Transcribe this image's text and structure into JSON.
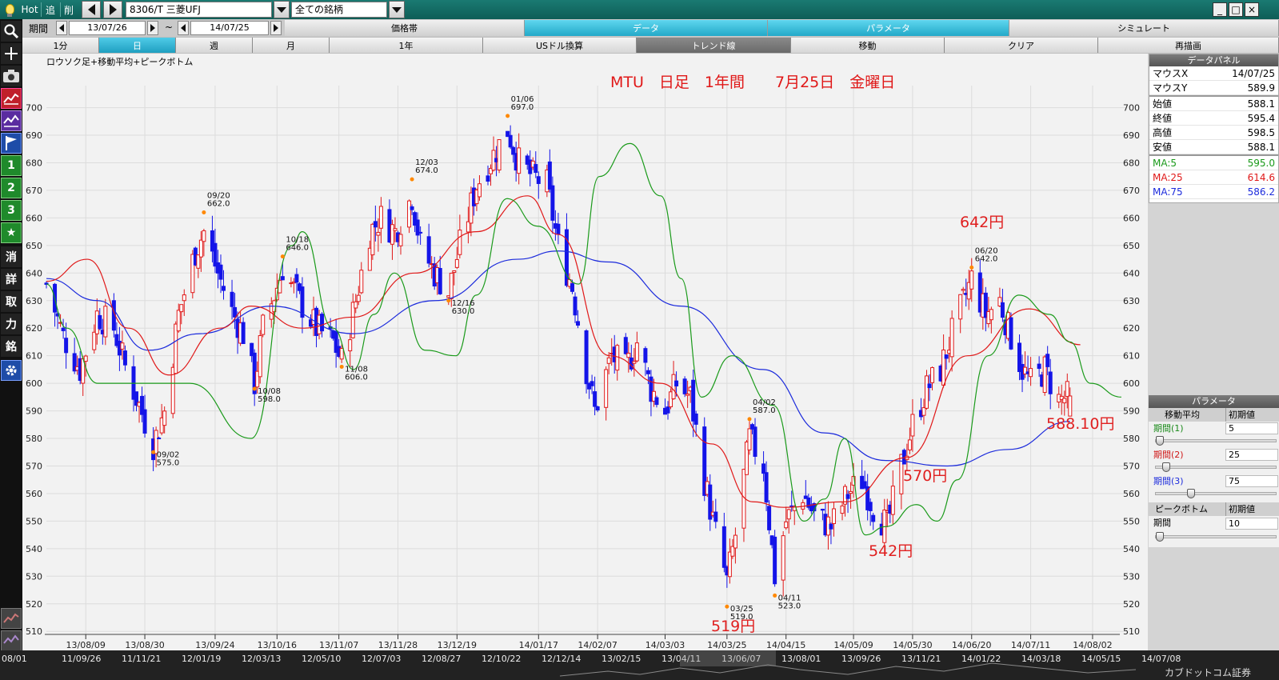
{
  "topbar": {
    "hot": "Hot",
    "add": "追",
    "del": "削",
    "symbol": "8306/T 三菱UFJ",
    "universe": "全ての銘柄",
    "win_min": "_",
    "win_max": "□",
    "win_close": "×"
  },
  "left_toolbar": [
    "1",
    "2",
    "3",
    "★",
    "消",
    "詳",
    "取",
    "力",
    "銘"
  ],
  "row2": {
    "period_label": "期間",
    "from": "13/07/26",
    "tilde": "~",
    "to": "14/07/25",
    "tabs": [
      {
        "label": "価格帯",
        "selected": false
      },
      {
        "label": "データ",
        "selected": true
      },
      {
        "label": "パラメータ",
        "selected": true
      },
      {
        "label": "シミュレート",
        "selected": false
      }
    ]
  },
  "row3": {
    "tabs": [
      {
        "label": "1分",
        "state": "normal"
      },
      {
        "label": "日",
        "state": "sel"
      },
      {
        "label": "週",
        "state": "normal"
      },
      {
        "label": "月",
        "state": "normal"
      },
      {
        "label": "1年",
        "state": "normal"
      },
      {
        "label": "USドル換算",
        "state": "normal"
      },
      {
        "label": "トレンド線",
        "state": "dark"
      },
      {
        "label": "移動",
        "state": "normal"
      },
      {
        "label": "クリア",
        "state": "normal"
      },
      {
        "label": "再描画",
        "state": "normal"
      }
    ]
  },
  "chart_title": "ロウソク足+移動平均+ピークボトム",
  "chart_data": {
    "type": "candlestick",
    "headline": "MTU　日足　1年間　　7月25日　金曜日",
    "ylim": [
      506,
      708
    ],
    "yticks": [
      510,
      520,
      530,
      540,
      550,
      560,
      570,
      580,
      590,
      600,
      610,
      620,
      630,
      640,
      650,
      660,
      670,
      680,
      690,
      700
    ],
    "x_start": "13/07/26",
    "x_end": "14/08/06",
    "xticks": [
      "13/08/09",
      "13/08/30",
      "13/09/24",
      "13/10/16",
      "13/11/07",
      "13/11/28",
      "13/12/19",
      "14/01/17",
      "14/02/07",
      "14/03/03",
      "14/03/25",
      "14/04/15",
      "14/05/09",
      "14/05/30",
      "14/06/20",
      "14/07/11",
      "14/08/02"
    ],
    "closes": [
      [
        "13/07/26",
        636
      ],
      [
        "13/08/01",
        617
      ],
      [
        "13/08/07",
        605
      ],
      [
        "13/08/13",
        625
      ],
      [
        "13/08/19",
        620
      ],
      [
        "13/08/23",
        606
      ],
      [
        "13/08/28",
        592
      ],
      [
        "13/09/02",
        578
      ],
      [
        "13/09/06",
        590
      ],
      [
        "13/09/11",
        625
      ],
      [
        "13/09/17",
        648
      ],
      [
        "13/09/20",
        655
      ],
      [
        "13/09/25",
        640
      ],
      [
        "13/09/30",
        626
      ],
      [
        "13/10/04",
        618
      ],
      [
        "13/10/08",
        600
      ],
      [
        "13/10/11",
        620
      ],
      [
        "13/10/16",
        635
      ],
      [
        "13/10/18",
        642
      ],
      [
        "13/10/24",
        630
      ],
      [
        "13/10/30",
        620
      ],
      [
        "13/11/05",
        615
      ],
      [
        "13/11/08",
        608
      ],
      [
        "13/11/13",
        630
      ],
      [
        "13/11/18",
        655
      ],
      [
        "13/11/22",
        660
      ],
      [
        "13/11/27",
        655
      ],
      [
        "13/12/03",
        668
      ],
      [
        "13/12/06",
        650
      ],
      [
        "13/12/11",
        640
      ],
      [
        "13/12/16",
        633
      ],
      [
        "13/12/20",
        650
      ],
      [
        "13/12/26",
        672
      ],
      [
        "14/01/06",
        692
      ],
      [
        "14/01/10",
        680
      ],
      [
        "14/01/15",
        675
      ],
      [
        "14/01/20",
        672
      ],
      [
        "14/01/24",
        650
      ],
      [
        "14/01/29",
        635
      ],
      [
        "14/02/03",
        605
      ],
      [
        "14/02/06",
        590
      ],
      [
        "14/02/12",
        610
      ],
      [
        "14/02/17",
        605
      ],
      [
        "14/02/21",
        615
      ],
      [
        "14/02/26",
        598
      ],
      [
        "14/03/03",
        590
      ],
      [
        "14/03/07",
        600
      ],
      [
        "14/03/12",
        595
      ],
      [
        "14/03/17",
        565
      ],
      [
        "14/03/20",
        550
      ],
      [
        "14/03/25",
        528
      ],
      [
        "14/03/28",
        545
      ],
      [
        "14/04/02",
        580
      ],
      [
        "14/04/07",
        570
      ],
      [
        "14/04/11",
        530
      ],
      [
        "14/04/15",
        550
      ],
      [
        "14/04/21",
        560
      ],
      [
        "14/04/25",
        552
      ],
      [
        "14/05/01",
        548
      ],
      [
        "14/05/07",
        560
      ],
      [
        "14/05/12",
        565
      ],
      [
        "14/05/16",
        555
      ],
      [
        "14/05/21",
        548
      ],
      [
        "14/05/26",
        570
      ],
      [
        "14/05/30",
        585
      ],
      [
        "14/06/04",
        598
      ],
      [
        "14/06/09",
        605
      ],
      [
        "14/06/13",
        618
      ],
      [
        "14/06/18",
        632
      ],
      [
        "14/06/20",
        638
      ],
      [
        "14/06/25",
        625
      ],
      [
        "14/06/30",
        630
      ],
      [
        "14/07/03",
        620
      ],
      [
        "14/07/08",
        605
      ],
      [
        "14/07/11",
        600
      ],
      [
        "14/07/16",
        605
      ],
      [
        "14/07/21",
        594
      ],
      [
        "14/07/25",
        595.4
      ]
    ],
    "ma5": [
      [
        0,
        636
      ],
      [
        0.02,
        620
      ],
      [
        0.05,
        600
      ],
      [
        0.1,
        600
      ],
      [
        0.14,
        600
      ],
      [
        0.2,
        580
      ],
      [
        0.24,
        650
      ],
      [
        0.25,
        655
      ],
      [
        0.28,
        620
      ],
      [
        0.3,
        605
      ],
      [
        0.32,
        625
      ],
      [
        0.34,
        640
      ],
      [
        0.37,
        612
      ],
      [
        0.4,
        610
      ],
      [
        0.42,
        632
      ],
      [
        0.45,
        667
      ],
      [
        0.48,
        657
      ],
      [
        0.52,
        636
      ],
      [
        0.54,
        675
      ],
      [
        0.57,
        687
      ],
      [
        0.6,
        668
      ],
      [
        0.62,
        638
      ],
      [
        0.64,
        595
      ],
      [
        0.67,
        610
      ],
      [
        0.71,
        592
      ],
      [
        0.74,
        550
      ],
      [
        0.76,
        558
      ],
      [
        0.78,
        580
      ],
      [
        0.8,
        545
      ],
      [
        0.82,
        548
      ],
      [
        0.85,
        556
      ],
      [
        0.87,
        550
      ],
      [
        0.89,
        565
      ],
      [
        0.92,
        610
      ],
      [
        0.95,
        632
      ],
      [
        0.98,
        625
      ],
      [
        1.0,
        615
      ],
      [
        1.02,
        600
      ],
      [
        1.05,
        595
      ]
    ],
    "ma25": [
      [
        0,
        637
      ],
      [
        0.04,
        645
      ],
      [
        0.08,
        620
      ],
      [
        0.12,
        603
      ],
      [
        0.17,
        620
      ],
      [
        0.2,
        628
      ],
      [
        0.25,
        620
      ],
      [
        0.3,
        624
      ],
      [
        0.36,
        640
      ],
      [
        0.42,
        655
      ],
      [
        0.47,
        668
      ],
      [
        0.5,
        654
      ],
      [
        0.55,
        610
      ],
      [
        0.6,
        600
      ],
      [
        0.65,
        578
      ],
      [
        0.69,
        557
      ],
      [
        0.72,
        555
      ],
      [
        0.78,
        557
      ],
      [
        0.84,
        573
      ],
      [
        0.9,
        610
      ],
      [
        0.96,
        627
      ],
      [
        1.01,
        614
      ]
    ],
    "ma75": [
      [
        0,
        638
      ],
      [
        0.05,
        630
      ],
      [
        0.1,
        612
      ],
      [
        0.15,
        618
      ],
      [
        0.22,
        628
      ],
      [
        0.3,
        618
      ],
      [
        0.38,
        630
      ],
      [
        0.46,
        645
      ],
      [
        0.5,
        648
      ],
      [
        0.55,
        644
      ],
      [
        0.62,
        628
      ],
      [
        0.7,
        605
      ],
      [
        0.76,
        582
      ],
      [
        0.82,
        572
      ],
      [
        0.88,
        570
      ],
      [
        0.94,
        576
      ],
      [
        1.0,
        586.2
      ]
    ],
    "peaks": [
      {
        "date": "09/02",
        "value": "575.0",
        "kind": "bottom"
      },
      {
        "date": "09/20",
        "value": "662.0",
        "kind": "top"
      },
      {
        "date": "10/08",
        "value": "598.0",
        "kind": "bottom"
      },
      {
        "date": "10/18",
        "value": "646.0",
        "kind": "top"
      },
      {
        "date": "11/08",
        "value": "606.0",
        "kind": "bottom"
      },
      {
        "date": "12/03",
        "value": "674.0",
        "kind": "top"
      },
      {
        "date": "12/16",
        "value": "630.0",
        "kind": "bottom"
      },
      {
        "date": "01/06",
        "value": "697.0",
        "kind": "top"
      },
      {
        "date": "03/25",
        "value": "519.0",
        "kind": "bottom"
      },
      {
        "date": "04/02",
        "value": "587.0",
        "kind": "top"
      },
      {
        "date": "04/11",
        "value": "523.0",
        "kind": "bottom"
      },
      {
        "date": "06/20",
        "value": "642.0",
        "kind": "top"
      }
    ],
    "annotations": [
      {
        "text": "642円",
        "color": "#e02020"
      },
      {
        "text": "570円",
        "color": "#e02020"
      },
      {
        "text": "542円",
        "color": "#e02020"
      },
      {
        "text": "519円",
        "color": "#e02020"
      },
      {
        "text": "588.10円",
        "color": "#e02020"
      }
    ],
    "ma_colors": {
      "ma5": "#1a9a1a",
      "ma25": "#e01818",
      "ma75": "#1c2bdc"
    }
  },
  "data_panel": {
    "title": "データパネル",
    "rows": [
      {
        "k": "マウスX",
        "v": "14/07/25"
      },
      {
        "k": "マウスY",
        "v": "589.9"
      },
      {
        "k": "始値",
        "v": "588.1"
      },
      {
        "k": "終値",
        "v": "595.4"
      },
      {
        "k": "高値",
        "v": "598.5"
      },
      {
        "k": "安値",
        "v": "588.1"
      }
    ],
    "ma_rows": [
      {
        "k": "MA:5",
        "v": "595.0",
        "color": "#1a9a1a"
      },
      {
        "k": "MA:25",
        "v": "614.6",
        "color": "#e01818"
      },
      {
        "k": "MA:75",
        "v": "586.2",
        "color": "#1c2bdc"
      }
    ]
  },
  "param_panel": {
    "title": "パラメータ",
    "ma_label": "移動平均",
    "init_label": "初期値",
    "periods": [
      {
        "label": "期間(1)",
        "value": "5",
        "color": "#1a8a1a",
        "level": 0.0
      },
      {
        "label": "期間(2)",
        "value": "25",
        "color": "#d01818",
        "level": 0.06
      },
      {
        "label": "期間(3)",
        "value": "75",
        "color": "#1c2bdc",
        "level": 0.28
      }
    ],
    "pb_label": "ピークボトム",
    "pb_init": "初期値",
    "pb_period_label": "期間",
    "pb_period_value": "10",
    "pb_level": 0.0
  },
  "bottom_dates": [
    "08/01",
    "11/09/26",
    "11/11/21",
    "12/01/19",
    "12/03/13",
    "12/05/10",
    "12/07/03",
    "12/08/27",
    "12/10/22",
    "12/12/14",
    "13/02/15",
    "13/04/11",
    "13/06/07",
    "13/08/01",
    "13/09/26",
    "13/11/21",
    "14/01/22",
    "14/03/18",
    "14/05/15",
    "14/07/08"
  ],
  "bottom_logo": "カブドットコム証券"
}
